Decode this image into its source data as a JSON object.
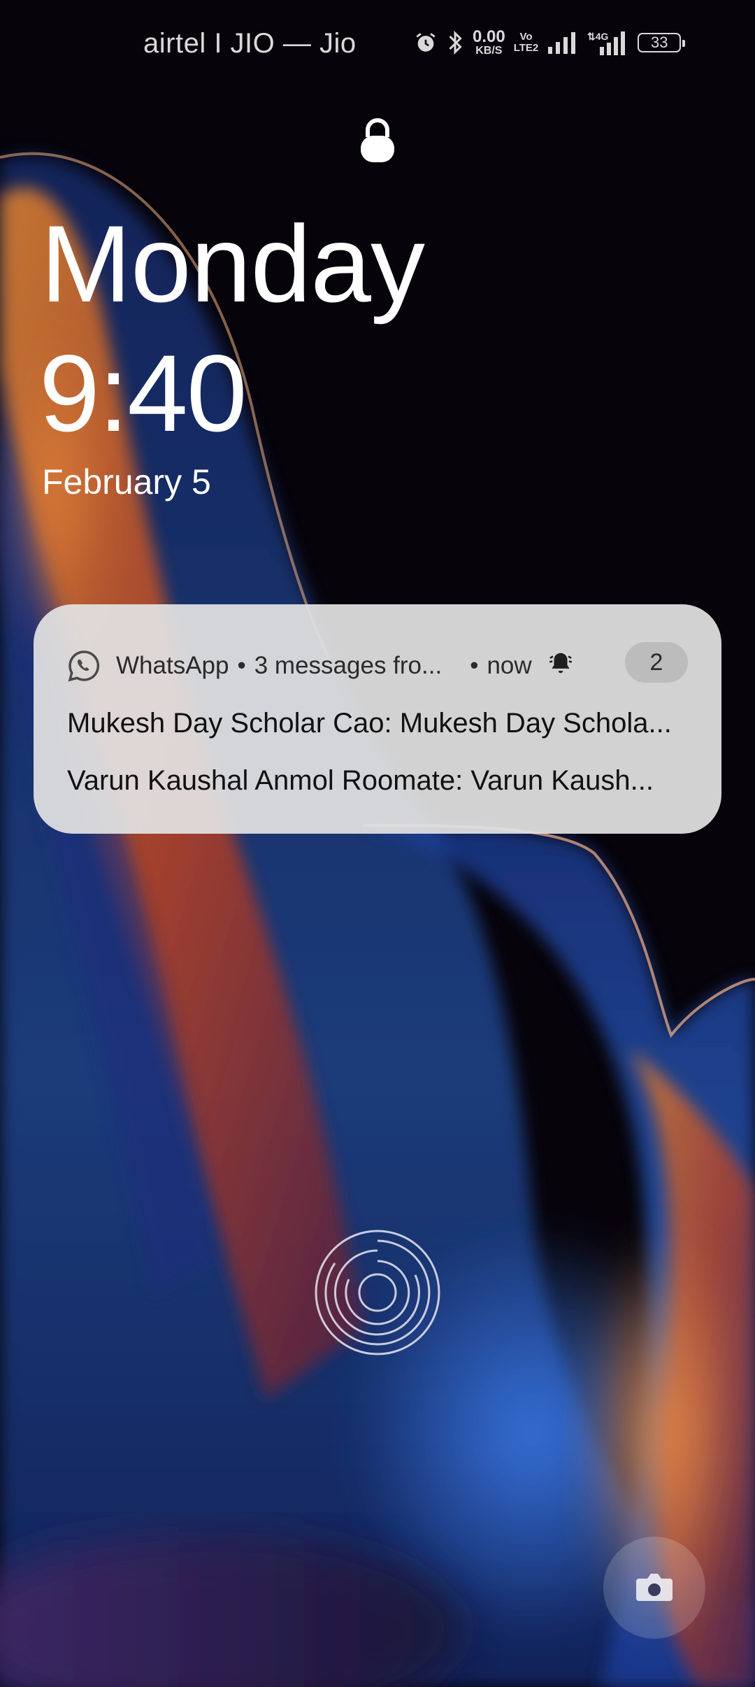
{
  "status_bar": {
    "carrier": "airtel I JIO — Jio",
    "net_speed_value": "0.00",
    "net_speed_unit": "KB/S",
    "volte_top": "Vo",
    "volte_bottom": "LTE2",
    "network_type": "4G",
    "battery_level": "33",
    "icons": [
      "alarm-icon",
      "bluetooth-icon",
      "signal-icon",
      "signal-4g-icon",
      "battery-icon"
    ]
  },
  "lock_screen": {
    "day": "Monday",
    "time": "9:40",
    "date": "February 5"
  },
  "notification": {
    "app_name": "WhatsApp",
    "summary": "3 messages fro...",
    "separator": "•",
    "time": "now",
    "count": "2",
    "messages": [
      "Mukesh Day Scholar Cao: Mukesh Day Schola...",
      "Varun Kaushal Anmol Roomate: Varun Kaush..."
    ]
  },
  "colors": {
    "notification_bg": "#e2e2e2",
    "wallpaper_orange": "#e0782a",
    "wallpaper_blue": "#2e62c8",
    "text_white": "#ffffff"
  }
}
